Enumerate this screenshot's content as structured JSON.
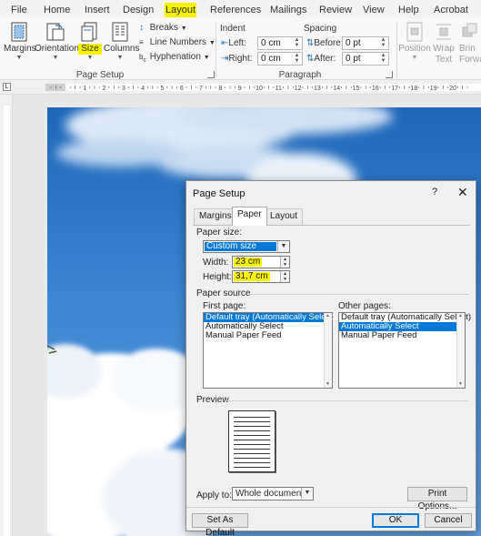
{
  "tabs": [
    "File",
    "Home",
    "Insert",
    "Design",
    "Layout",
    "References",
    "Mailings",
    "Review",
    "View",
    "Help",
    "Acrobat"
  ],
  "active_tab": "Layout",
  "highlight_color": "#f6f200",
  "accent_color": "#0078d7",
  "ribbon": {
    "margins": "Margins",
    "orientation": "Orientation",
    "size": "Size",
    "columns": "Columns",
    "breaks": "Breaks",
    "line_numbers": "Line Numbers",
    "hyphenation": "Hyphenation",
    "page_setup_group": "Page Setup",
    "indent_title": "Indent",
    "indent_left_label": "Left:",
    "indent_left_value": "0 cm",
    "indent_right_label": "Right:",
    "indent_right_value": "0 cm",
    "spacing_title": "Spacing",
    "spacing_before_label": "Before:",
    "spacing_before_value": "0 pt",
    "spacing_after_label": "After:",
    "spacing_after_value": "0 pt",
    "paragraph_group": "Paragraph",
    "position": "Position",
    "wrap_text_1": "Wrap",
    "wrap_text_2": "Text",
    "bring_forward_1": "Brin",
    "bring_forward_2": "Forwa"
  },
  "ruler_numbers": [
    "2",
    "1",
    "1",
    "2",
    "3",
    "4",
    "5",
    "6",
    "7",
    "8",
    "9",
    "10",
    "11",
    "12",
    "13",
    "14",
    "15",
    "16",
    "17",
    "18",
    "19",
    "20"
  ],
  "dialog": {
    "title": "Page Setup",
    "help": "?",
    "close": "✕",
    "tabs": [
      "Margins",
      "Paper",
      "Layout"
    ],
    "active_tab": "Paper",
    "paper_size_label": "Paper size:",
    "paper_size_value": "Custom size",
    "width_label": "Width:",
    "width_value": "23 cm",
    "height_label": "Height:",
    "height_value": "31,7 cm",
    "paper_source_label": "Paper source",
    "first_page_label": "First page:",
    "first_page_items": [
      "Default tray (Automatically Select)",
      "Automatically Select",
      "Manual Paper Feed"
    ],
    "other_pages_label": "Other pages:",
    "other_pages_items": [
      "Default tray (Automatically Select)",
      "Automatically Select",
      "Manual Paper Feed"
    ],
    "preview_label": "Preview",
    "apply_to_label": "Apply to:",
    "apply_to_value": "Whole document",
    "print_options": "Print Options...",
    "set_as_default": "Set As Default",
    "ok": "OK",
    "cancel": "Cancel"
  }
}
